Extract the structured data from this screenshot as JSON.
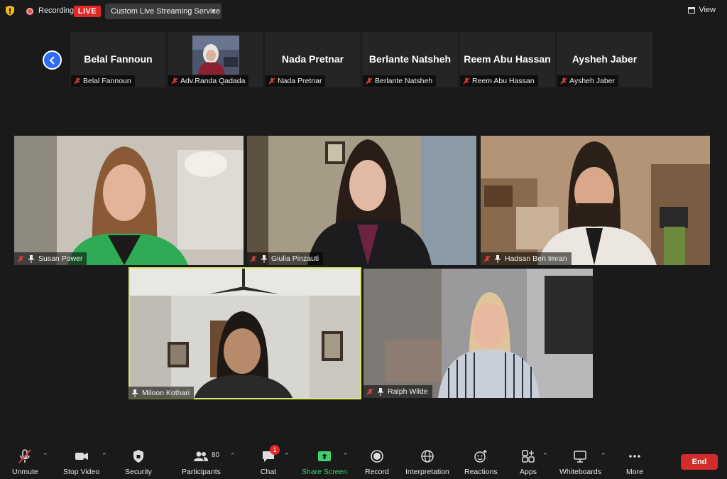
{
  "topbar": {
    "recording_label": "Recording",
    "live_badge": "LIVE",
    "stream_service": "Custom Live Streaming Service",
    "view_label": "View"
  },
  "strip": {
    "thumbnails": [
      {
        "display": "Belal Fannoun",
        "label": "Belal Fannoun"
      },
      {
        "display": "",
        "label": "Adv.Randa Qadada"
      },
      {
        "display": "Nada Pretnar",
        "label": "Nada Pretnar"
      },
      {
        "display": "Berlante Natsheh",
        "label": "Berlante Natsheh"
      },
      {
        "display": "Reem Abu Hassan",
        "label": "Reem Abu Hassan"
      },
      {
        "display": "Aysheh Jaber",
        "label": "Aysheh Jaber"
      }
    ]
  },
  "tiles": [
    {
      "name": "Susan Power"
    },
    {
      "name": "Giulia Pinzauti"
    },
    {
      "name": "Hadsan Ben Imran"
    },
    {
      "name": "Miloon Kothari"
    },
    {
      "name": "Ralph Wilde"
    }
  ],
  "toolbar": {
    "unmute": "Unmute",
    "stop_video": "Stop Video",
    "security": "Security",
    "participants": "Participants",
    "participants_count": "80",
    "chat": "Chat",
    "chat_badge": "1",
    "share_screen": "Share Screen",
    "record": "Record",
    "interpretation": "Interpretation",
    "reactions": "Reactions",
    "apps": "Apps",
    "whiteboards": "Whiteboards",
    "more": "More",
    "end": "End"
  },
  "colors": {
    "live_red": "#e02828",
    "share_green": "#3fd26b",
    "active_speaker_border": "#d8e86a",
    "back_button_blue": "#2d6cf6"
  }
}
